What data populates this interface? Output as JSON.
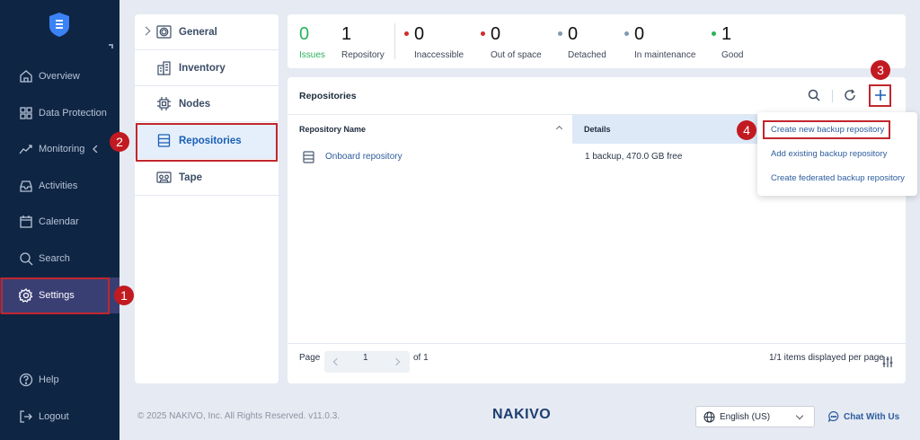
{
  "sidebar": {
    "items": [
      {
        "label": "Overview",
        "icon": "home-icon"
      },
      {
        "label": "Data Protection",
        "icon": "grid-icon"
      },
      {
        "label": "Monitoring",
        "icon": "chart-line-icon"
      },
      {
        "label": "Activities",
        "icon": "inbox-icon"
      },
      {
        "label": "Calendar",
        "icon": "calendar-icon"
      },
      {
        "label": "Search",
        "icon": "search-icon"
      },
      {
        "label": "Settings",
        "icon": "gear-icon"
      }
    ],
    "help": "Help",
    "logout": "Logout"
  },
  "submenu": {
    "items": [
      {
        "label": "General",
        "icon": "gear-box-icon"
      },
      {
        "label": "Inventory",
        "icon": "buildings-icon"
      },
      {
        "label": "Nodes",
        "icon": "chip-icon"
      },
      {
        "label": "Repositories",
        "icon": "database-icon"
      },
      {
        "label": "Tape",
        "icon": "tape-icon"
      }
    ]
  },
  "status": {
    "issues": {
      "value": "0",
      "label": "Issues"
    },
    "repository": {
      "value": "1",
      "label": "Repository"
    },
    "inaccessible": {
      "value": "0",
      "label": "Inaccessible"
    },
    "out_of_space": {
      "value": "0",
      "label": "Out of space"
    },
    "detached": {
      "value": "0",
      "label": "Detached"
    },
    "in_maintenance": {
      "value": "0",
      "label": "In maintenance"
    },
    "good": {
      "value": "1",
      "label": "Good"
    }
  },
  "panel": {
    "title": "Repositories",
    "columns": [
      "Repository Name",
      "Details"
    ],
    "rows": [
      {
        "name": "Onboard repository",
        "details": "1 backup, 470.0 GB free"
      }
    ],
    "pager": {
      "page_label": "Page",
      "page_value": "1",
      "of_label": "of 1",
      "items_label": "1/1 items displayed per page"
    }
  },
  "dropdown": {
    "items": [
      "Create new backup repository",
      "Add existing backup repository",
      "Create federated backup repository"
    ]
  },
  "badges": [
    "1",
    "2",
    "3",
    "4"
  ],
  "footer": {
    "copyright": "© 2025 NAKIVO, Inc. All Rights Reserved. v11.0.3.",
    "brand": "NAKIVO",
    "language": "English (US)",
    "chat": "Chat With Us"
  },
  "colors": {
    "sidebar_bg": "#0f2544",
    "active_nav": "#3a3f73",
    "accent_blue": "#1a5fb4",
    "annotation_red": "#c21a21",
    "status_red": "#d22b2b",
    "status_grey": "#8397b3",
    "status_green": "#27b35a"
  }
}
